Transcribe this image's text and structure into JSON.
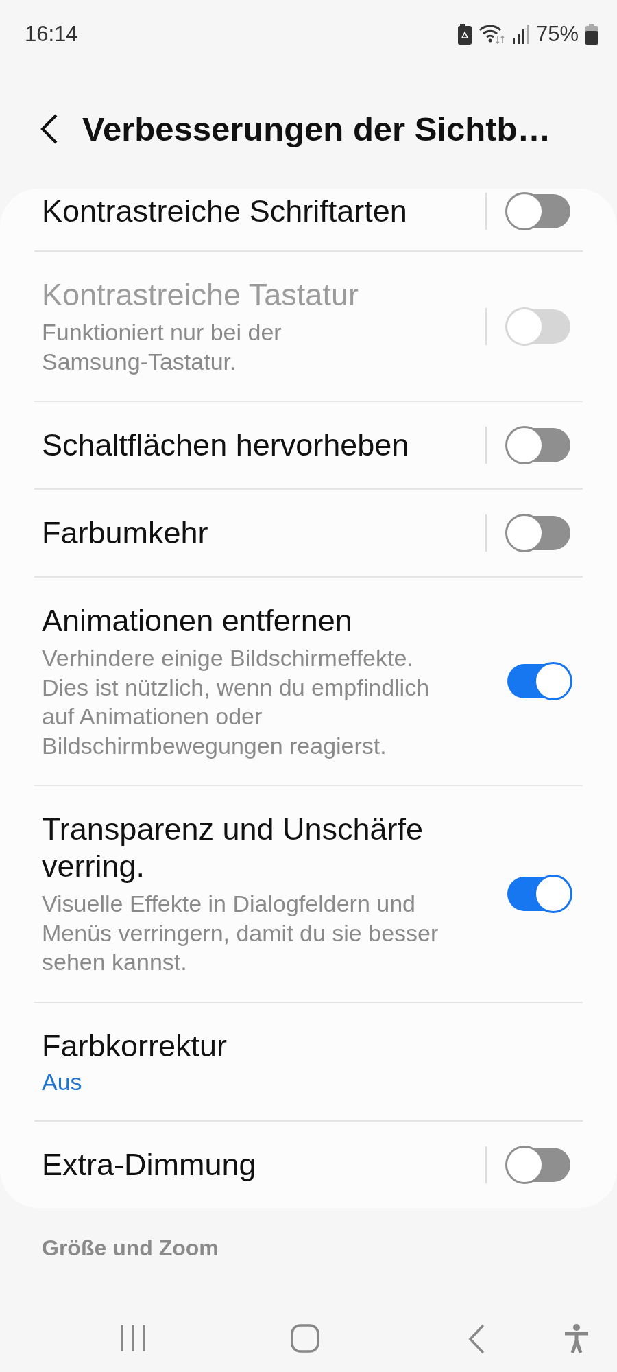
{
  "status_bar": {
    "time": "16:14",
    "battery": "75%"
  },
  "header": {
    "title": "Verbesserungen der Sichtb…"
  },
  "settings": [
    {
      "kind": "toggle",
      "title": "Kontrastreiche Schriftarten",
      "on": false,
      "disabled": false
    },
    {
      "kind": "toggle",
      "title": "Kontrastreiche Tastatur",
      "subtitle": "Funktioniert nur bei der Samsung-Tastatur.",
      "on": false,
      "disabled": true
    },
    {
      "kind": "toggle",
      "title": "Schaltflächen hervorheben",
      "on": false,
      "disabled": false
    },
    {
      "kind": "toggle",
      "title": "Farbumkehr",
      "on": false,
      "disabled": false
    },
    {
      "kind": "toggle",
      "title": "Animationen entfernen",
      "subtitle": "Verhindere einige Bildschirmeffekte. Dies ist nützlich, wenn du empfindlich auf Animationen oder Bildschirmbewegungen reagierst.",
      "on": true,
      "disabled": false
    },
    {
      "kind": "toggle",
      "title": "Transparenz und Unschärfe verring.",
      "subtitle": "Visuelle Effekte in Dialogfeldern und Menüs verringern, damit du sie besser sehen kannst.",
      "on": true,
      "disabled": false
    },
    {
      "kind": "link",
      "title": "Farbkorrektur",
      "value": "Aus"
    },
    {
      "kind": "toggle",
      "title": "Extra-Dimmung",
      "on": false,
      "disabled": false
    }
  ],
  "next_section": {
    "title": "Größe und Zoom"
  }
}
